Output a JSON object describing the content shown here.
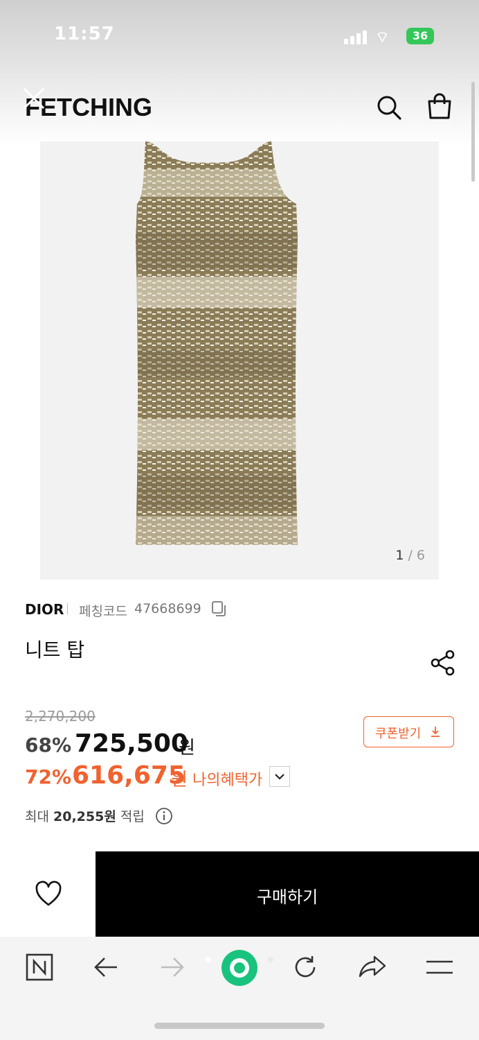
{
  "status_bar": {
    "time": "11:57",
    "battery": "36"
  },
  "header": {
    "brand_logo": "FETCHING"
  },
  "product": {
    "image_counter_current": "1",
    "image_counter_total": "6",
    "brand": "DIOR",
    "code_label": "페칭코드",
    "code_value": "47668699",
    "name": "니트 탑",
    "original_price": "2,270,200",
    "discount_pct": "68%",
    "sale_price": "725,500",
    "currency_unit": "원",
    "benefit_pct": "72%",
    "benefit_price": "616,675",
    "benefit_label": "나의혜택가",
    "coupon_label": "쿠폰받기",
    "points_prefix": "최대",
    "points_amount": "20,255원",
    "points_suffix": "적립"
  },
  "actions": {
    "buy_label": "구매하기"
  },
  "colors": {
    "accent": "#f0622f",
    "buy_bg": "#000000",
    "knit_olive": "#7d7050",
    "knit_beige": "#d8d2ba"
  },
  "icons": [
    "close-icon",
    "search-icon",
    "shopping-bag-icon",
    "copy-icon",
    "share-icon",
    "download-icon",
    "chevron-down-icon",
    "info-icon",
    "heart-icon",
    "naver-n-icon",
    "back-arrow-icon",
    "forward-arrow-icon",
    "green-action-icon",
    "reload-icon",
    "share-arrow-icon",
    "menu-icon"
  ]
}
